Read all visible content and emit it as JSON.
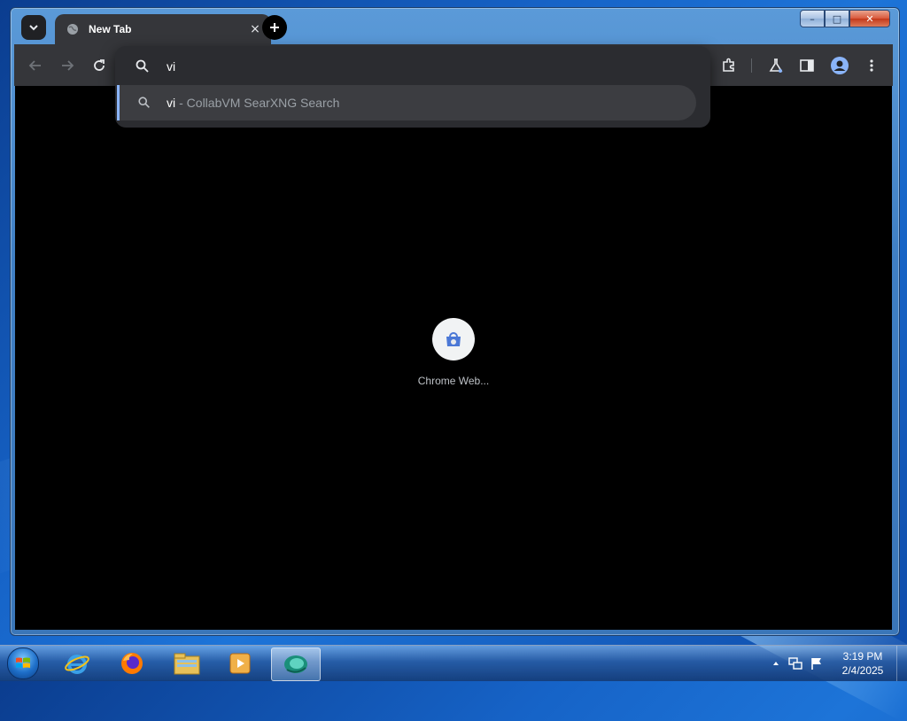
{
  "window": {
    "minimize_label": "–",
    "maximize_label": "□",
    "close_label": "✕"
  },
  "tabs": [
    {
      "title": "New Tab",
      "favicon": "globe-icon",
      "active": true
    }
  ],
  "tab_strip": {
    "close_label": "×",
    "new_tab_label": "+"
  },
  "toolbar": {
    "back_icon": "back-arrow-icon",
    "forward_icon": "forward-arrow-icon",
    "reload_icon": "reload-icon",
    "right_icons": [
      "extensions-icon",
      "labs-flask-icon",
      "side-panel-icon",
      "profile-avatar-icon",
      "more-menu-icon"
    ]
  },
  "omnibox": {
    "value": "vi",
    "suggestion": {
      "query": "vi",
      "description": "- CollabVM SearXNG Search",
      "icon": "search-icon"
    }
  },
  "new_tab_page": {
    "shortcut_label": "Chrome Web...",
    "shortcut_icon": "chrome-web-store-icon"
  },
  "taskbar": {
    "apps": [
      "internet-explorer-icon",
      "firefox-icon",
      "file-explorer-icon",
      "media-player-icon",
      "chrome-app-icon"
    ],
    "active_app": "chrome-app-icon",
    "tray_icons": [
      "show-hidden-icons-arrow-icon",
      "network-icon",
      "action-center-flag-icon"
    ],
    "time": "3:19 PM",
    "date": "2/4/2025"
  },
  "colors": {
    "chrome_dark": "#35363a",
    "omnibox_bg": "#2b2c30",
    "suggestion_highlight": "#8ab4f8",
    "page_bg": "#000000"
  }
}
